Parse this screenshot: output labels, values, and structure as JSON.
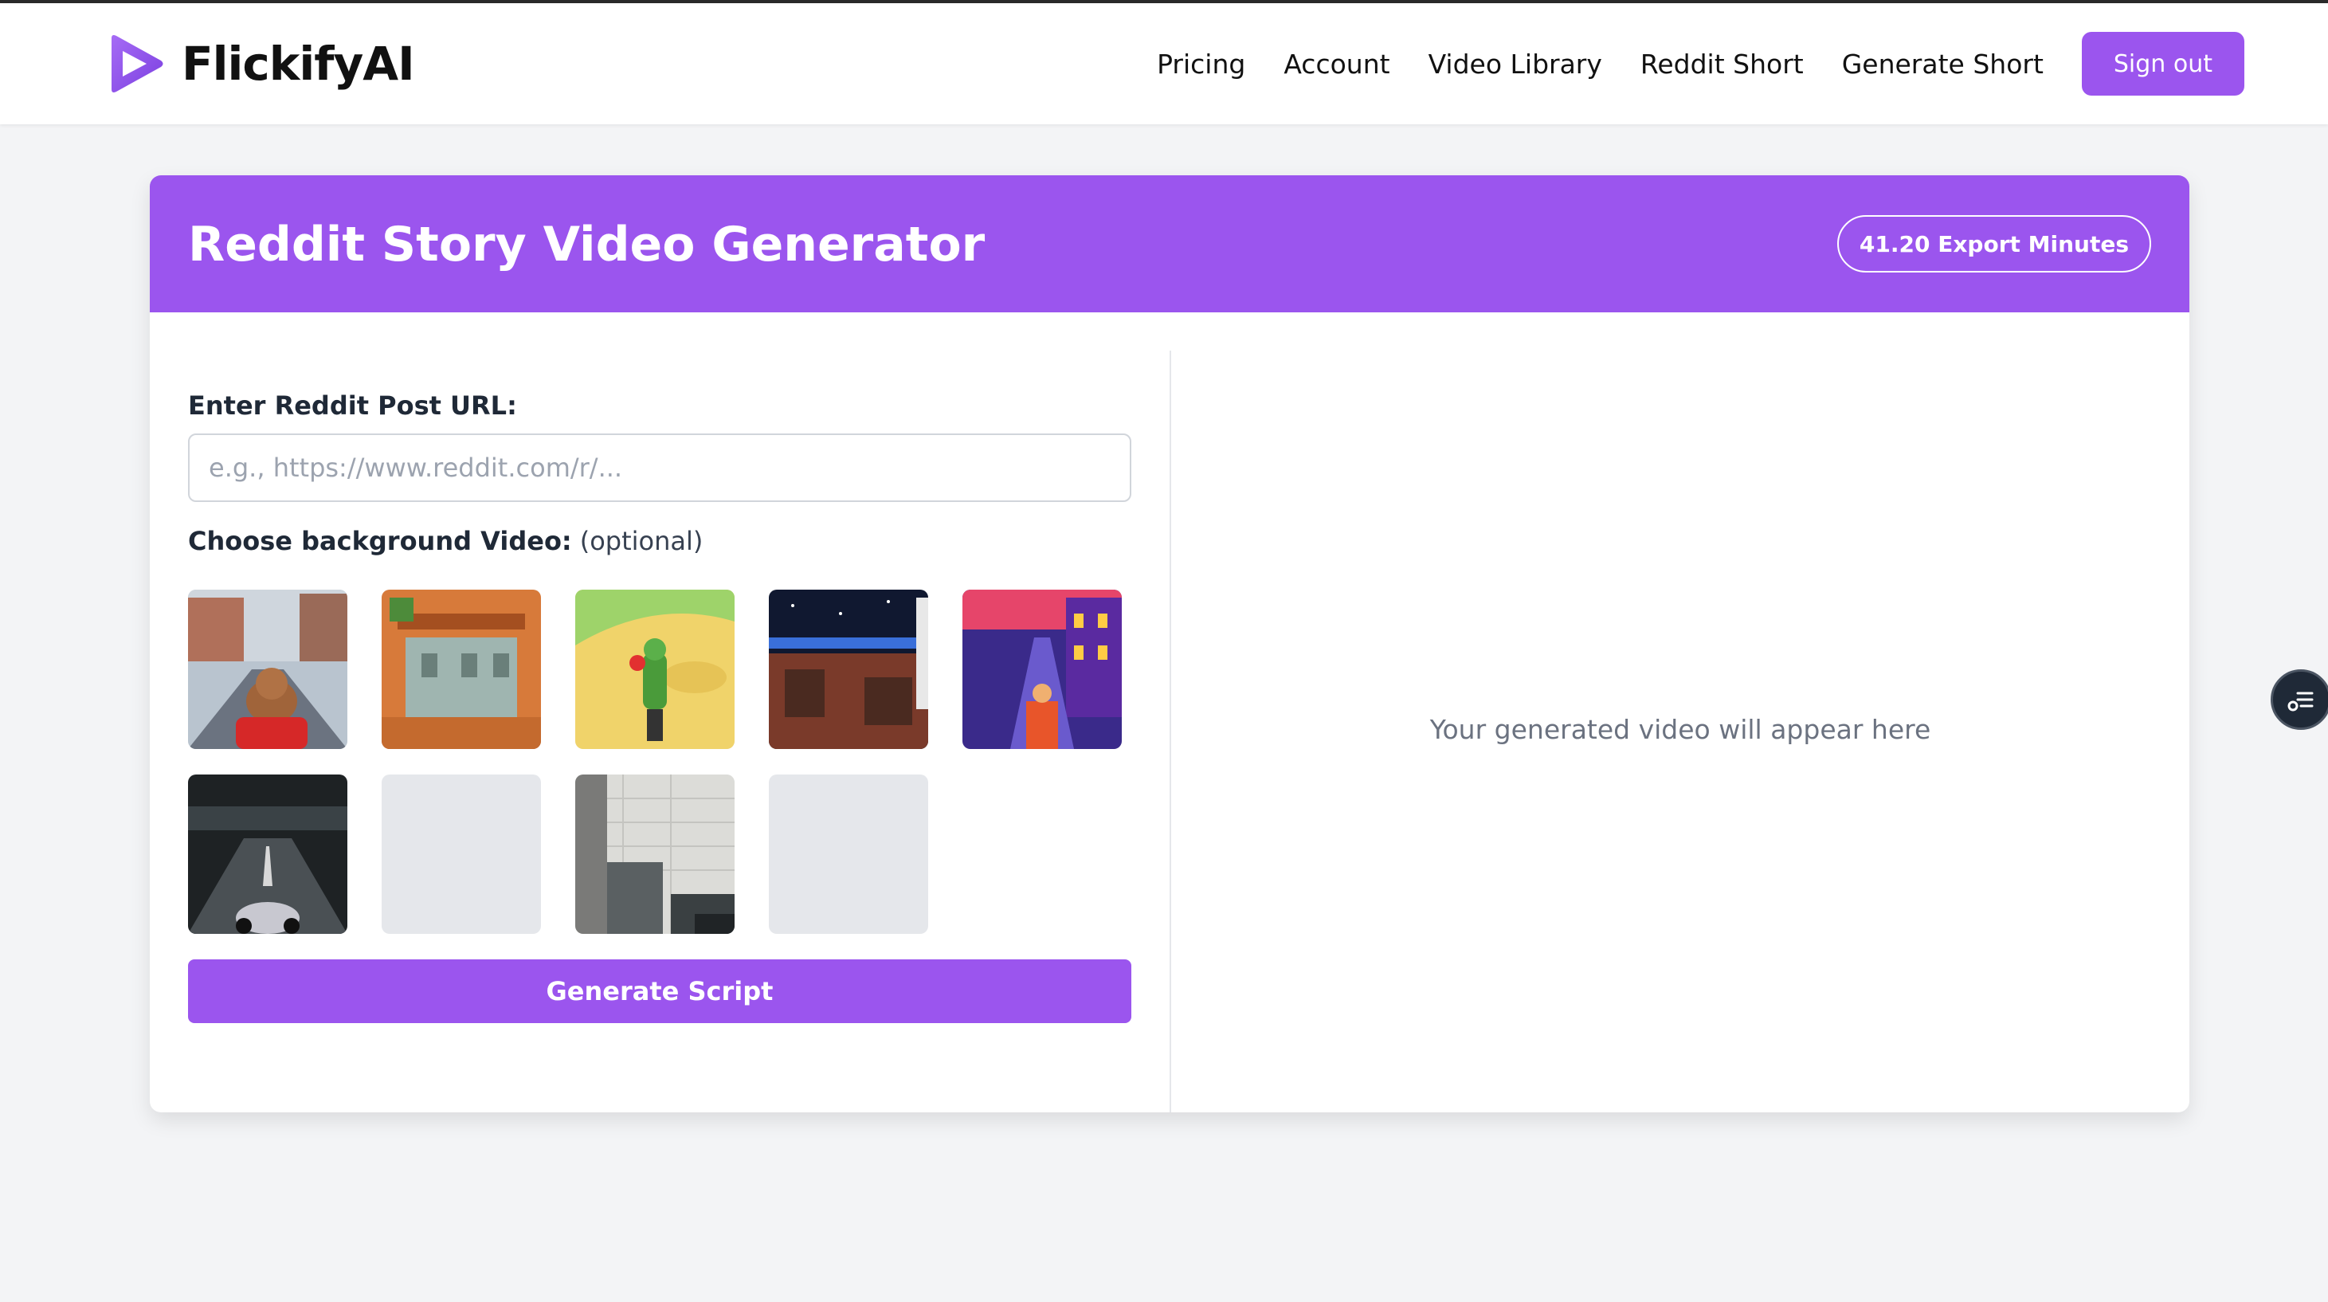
{
  "brand": {
    "name": "FlickifyAI",
    "logo_icon": "play-triangle-logo-icon"
  },
  "nav": {
    "items": [
      "Pricing",
      "Account",
      "Video Library",
      "Reddit Short",
      "Generate Short"
    ],
    "sign_out": "Sign out"
  },
  "card": {
    "title": "Reddit Story Video Generator",
    "minutes_badge": "41.20 Export Minutes"
  },
  "form": {
    "url_label": "Enter Reddit Post URL:",
    "url_value": "",
    "url_placeholder": "e.g., https://www.reddit.com/r/...",
    "bg_label": "Choose background Video:",
    "bg_optional": "(optional)",
    "generate_label": "Generate Script"
  },
  "preview": {
    "placeholder": "Your generated video will appear here"
  },
  "colors": {
    "accent": "#9b55ee",
    "background": "#f3f4f6",
    "card": "#ffffff"
  },
  "floating_icon": "sliders-toggle-icon"
}
